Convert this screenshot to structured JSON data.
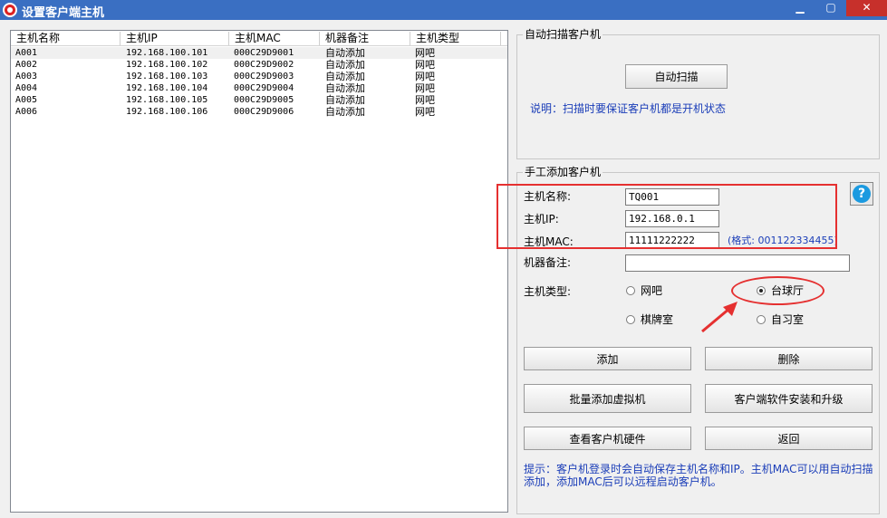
{
  "window": {
    "title": "设置客户端主机"
  },
  "list": {
    "columns": [
      "主机名称",
      "主机IP",
      "主机MAC",
      "机器备注",
      "主机类型"
    ],
    "rows": [
      [
        "A001",
        "192.168.100.101",
        "000C29D9001",
        "自动添加",
        "网吧"
      ],
      [
        "A002",
        "192.168.100.102",
        "000C29D9002",
        "自动添加",
        "网吧"
      ],
      [
        "A003",
        "192.168.100.103",
        "000C29D9003",
        "自动添加",
        "网吧"
      ],
      [
        "A004",
        "192.168.100.104",
        "000C29D9004",
        "自动添加",
        "网吧"
      ],
      [
        "A005",
        "192.168.100.105",
        "000C29D9005",
        "自动添加",
        "网吧"
      ],
      [
        "A006",
        "192.168.100.106",
        "000C29D9006",
        "自动添加",
        "网吧"
      ]
    ]
  },
  "auto_scan": {
    "group_title": "自动扫描客户机",
    "button": "自动扫描",
    "note": "说明：扫描时要保证客户机都是开机状态"
  },
  "manual_add": {
    "group_title": "手工添加客户机",
    "name_label": "主机名称:",
    "name_value": "TQ001",
    "ip_label": "主机IP:",
    "ip_value": "192.168.0.1",
    "mac_label": "主机MAC:",
    "mac_value": "11111222222",
    "mac_format": "(格式: 001122334455)",
    "remark_label": "机器备注:",
    "remark_value": "",
    "type_label": "主机类型:",
    "types": [
      {
        "label": "网吧",
        "checked": false
      },
      {
        "label": "台球厅",
        "checked": true
      },
      {
        "label": "棋牌室",
        "checked": false
      },
      {
        "label": "自习室",
        "checked": false
      }
    ]
  },
  "buttons": {
    "add": "添加",
    "delete": "删除",
    "batch_add": "批量添加虚拟机",
    "install_upgrade": "客户端软件安装和升级",
    "view_hardware": "查看客户机硬件",
    "back": "返回"
  },
  "hint": "提示：客户机登录时会自动保存主机名称和IP。主机MAC可以用自动扫描添加，添加MAC后可以远程启动客户机。",
  "colors": {
    "titlebar": "#3a6fc2",
    "blue_text": "#1a3db8",
    "annotation": "#e53030",
    "close": "#c7302b"
  },
  "icons": {
    "app": "app-icon",
    "help": "help-icon"
  }
}
